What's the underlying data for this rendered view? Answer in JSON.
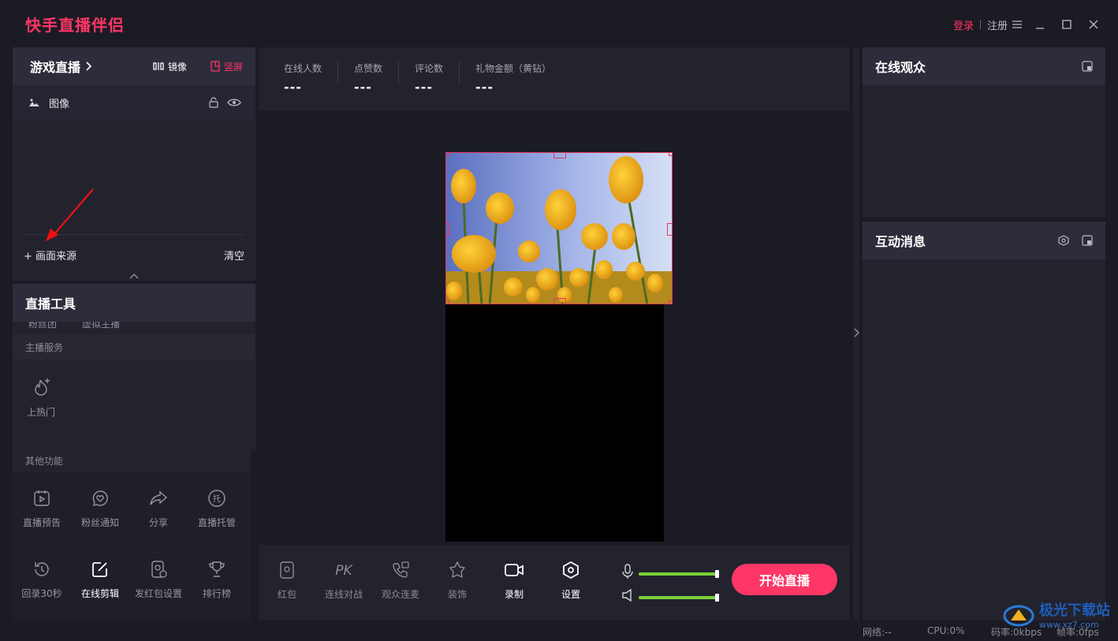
{
  "app": {
    "title": "快手直播伴侣",
    "login": "登录",
    "register": "注册"
  },
  "left": {
    "header": {
      "title": "游戏直播",
      "mirror": "镜像",
      "portrait": "竖屏"
    },
    "source": {
      "label": "图像"
    },
    "add_source": "画面来源",
    "clear": "清空"
  },
  "tools": {
    "title": "直播工具",
    "partial": [
      "粉丝团",
      "虚拟主播"
    ],
    "service_label": "主播服务",
    "service_items": [
      {
        "label": "上热门",
        "icon": "flame-plus-icon"
      }
    ],
    "other_label": "其他功能",
    "other_items": [
      {
        "label": "直播预告",
        "icon": "calendar-play-icon"
      },
      {
        "label": "粉丝通知",
        "icon": "heart-chat-icon"
      },
      {
        "label": "分享",
        "icon": "share-icon"
      },
      {
        "label": "直播托管",
        "icon": "hosting-icon"
      },
      {
        "label": "回录30秒",
        "icon": "replay-icon"
      },
      {
        "label": "在线剪辑",
        "icon": "edit-icon"
      },
      {
        "label": "发红包设置",
        "icon": "redpacket-settings-icon"
      },
      {
        "label": "排行榜",
        "icon": "trophy-icon"
      }
    ]
  },
  "stats": [
    {
      "label": "在线人数",
      "value": "---"
    },
    {
      "label": "点赞数",
      "value": "---"
    },
    {
      "label": "评论数",
      "value": "---"
    },
    {
      "label": "礼物金额（黄钻）",
      "value": "---"
    }
  ],
  "bottom": {
    "items": [
      {
        "label": "红包",
        "icon": "redpacket-icon"
      },
      {
        "label": "连线对战",
        "icon": "pk-icon"
      },
      {
        "label": "观众连麦",
        "icon": "call-icon"
      },
      {
        "label": "装饰",
        "icon": "decoration-icon"
      },
      {
        "label": "录制",
        "icon": "record-icon"
      },
      {
        "label": "设置",
        "icon": "settings-icon"
      }
    ],
    "mic_level": 1.0,
    "speaker_level": 1.0,
    "start": "开始直播"
  },
  "right": {
    "audience_title": "在线观众",
    "messages_title": "互动消息"
  },
  "status": {
    "network": "网络:--",
    "cpu": "CPU:0%",
    "bitrate": "码率:0kbps",
    "fps": "帧率:0fps"
  },
  "watermark": {
    "text": "极光下载站",
    "url": "www.xz7.com"
  },
  "colors": {
    "accent": "#fe3666",
    "bg": "#1b1b24",
    "panel": "#23232e",
    "level": "#7bd13a"
  }
}
